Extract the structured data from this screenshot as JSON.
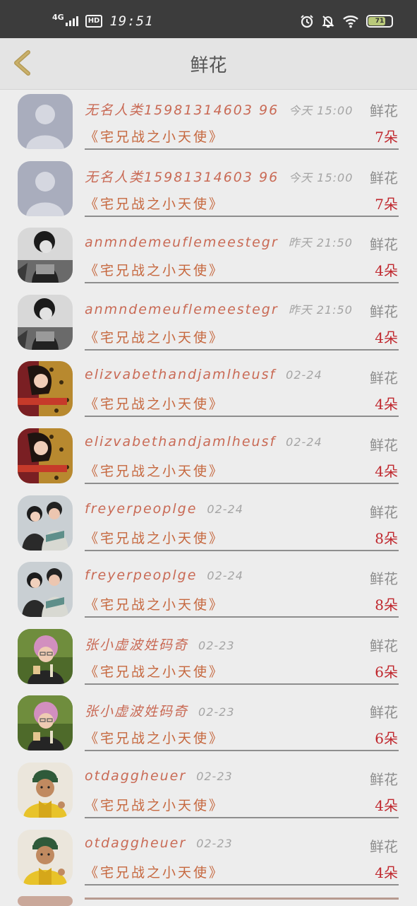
{
  "status_bar": {
    "network": "4G",
    "hd_badge": "HD",
    "time": "19:51",
    "battery_level": "71",
    "battery_fraction": 0.71
  },
  "header": {
    "back_icon": "chevron-left-icon",
    "title": "鲜花"
  },
  "records": [
    {
      "avatar": "default-avatar",
      "name": "无名人类15981314603 96",
      "time": "今天 15:00",
      "type": "鲜花",
      "gift": "《宅兄战之小天使》",
      "count": "7朵"
    },
    {
      "avatar": "default-avatar",
      "name": "无名人类15981314603 96",
      "time": "今天 15:00",
      "type": "鲜花",
      "gift": "《宅兄战之小天使》",
      "count": "7朵"
    },
    {
      "avatar": "bw-lady-avatar",
      "name": "anmndemeuflemeestegr",
      "time": "昨天 21:50",
      "type": "鲜花",
      "gift": "《宅兄战之小天使》",
      "count": "4朵"
    },
    {
      "avatar": "bw-lady-avatar",
      "name": "anmndemeuflemeestegr",
      "time": "昨天 21:50",
      "type": "鲜花",
      "gift": "《宅兄战之小天使》",
      "count": "4朵"
    },
    {
      "avatar": "leopard-girl-avatar",
      "name": "elizvabethandjamlheusf",
      "time": "02-24",
      "type": "鲜花",
      "gift": "《宅兄战之小天使》",
      "count": "4朵"
    },
    {
      "avatar": "leopard-girl-avatar",
      "name": "elizvabethandjamlheusf",
      "time": "02-24",
      "type": "鲜花",
      "gift": "《宅兄战之小天使》",
      "count": "4朵"
    },
    {
      "avatar": "couple-avatar",
      "name": "freyerpeoplge",
      "time": "02-24",
      "type": "鲜花",
      "gift": "《宅兄战之小天使》",
      "count": "8朵"
    },
    {
      "avatar": "couple-avatar",
      "name": "freyerpeoplge",
      "time": "02-24",
      "type": "鲜花",
      "gift": "《宅兄战之小天使》",
      "count": "8朵"
    },
    {
      "avatar": "pink-hair-avatar",
      "name": "张小虚波姓码奇",
      "time": "02-23",
      "type": "鲜花",
      "gift": "《宅兄战之小天使》",
      "count": "6朵"
    },
    {
      "avatar": "pink-hair-avatar",
      "name": "张小虚波姓码奇",
      "time": "02-23",
      "type": "鲜花",
      "gift": "《宅兄战之小天使》",
      "count": "6朵"
    },
    {
      "avatar": "kid-green-hat-avatar",
      "name": "otdaggheuer",
      "time": "02-23",
      "type": "鲜花",
      "gift": "《宅兄战之小天使》",
      "count": "4朵"
    },
    {
      "avatar": "kid-green-hat-avatar",
      "name": "otdaggheuer",
      "time": "02-23",
      "type": "鲜花",
      "gift": "《宅兄战之小天使》",
      "count": "4朵"
    }
  ]
}
